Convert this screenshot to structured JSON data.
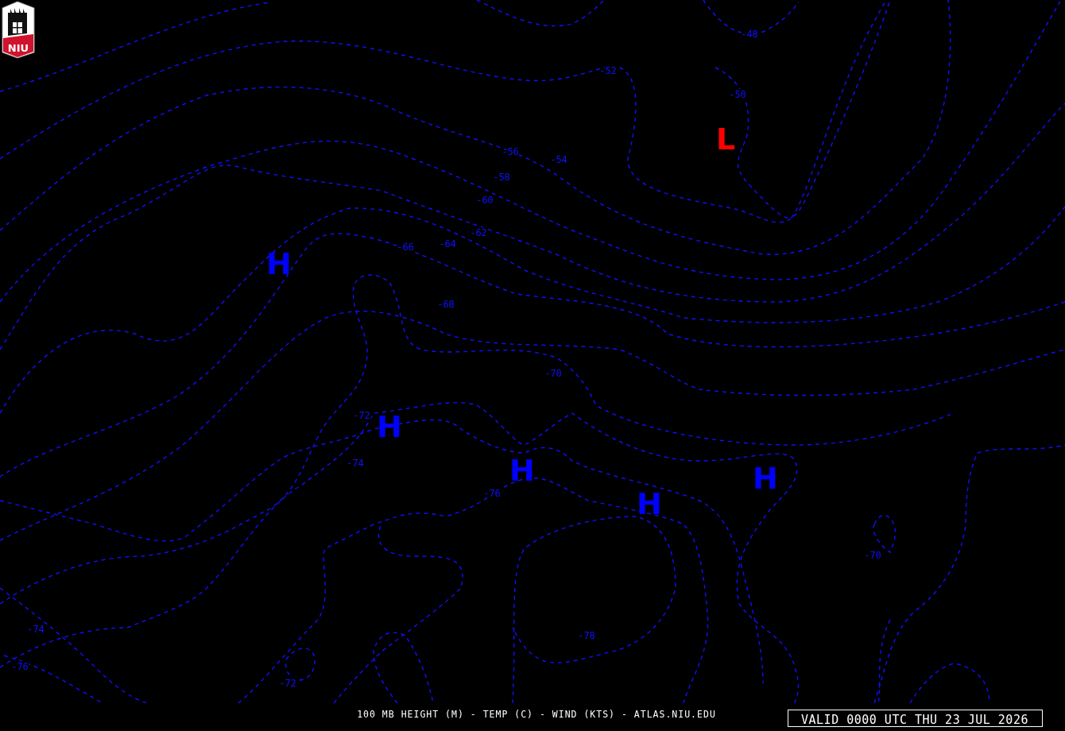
{
  "logo": {
    "text": "NIU"
  },
  "contour_labels": [
    "-48",
    "-52",
    "-50",
    "-56",
    "-54",
    "-58",
    "-60",
    "-62",
    "-64",
    "-66",
    "-68",
    "-70",
    "-72",
    "-74",
    "-76",
    "-78",
    "-70",
    "-74",
    "-76",
    "-72"
  ],
  "centers": [
    {
      "kind": "high",
      "text": "H"
    },
    {
      "kind": "high",
      "text": "H"
    },
    {
      "kind": "high",
      "text": "H"
    },
    {
      "kind": "high",
      "text": "H"
    },
    {
      "kind": "high",
      "text": "H"
    },
    {
      "kind": "low",
      "text": "L"
    }
  ],
  "caption": "100 MB HEIGHT (M) - TEMP (C) - WIND (KTS) - ATLAS.NIU.EDU",
  "valid_time": "VALID 0000 UTC THU 23 JUL 2026"
}
